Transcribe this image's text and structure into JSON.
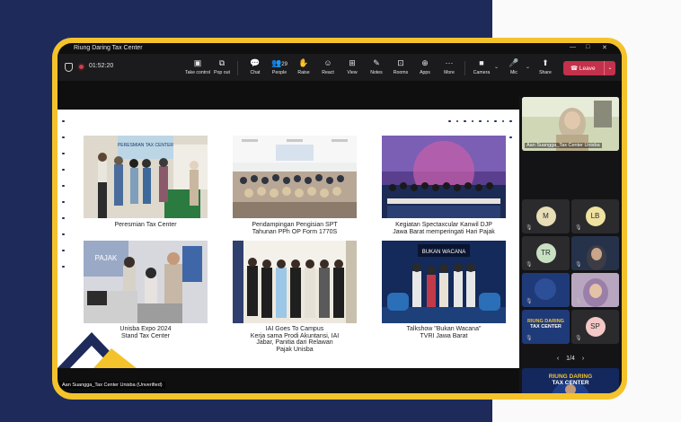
{
  "window": {
    "title": "Riung Daring Tax Center",
    "minimize": "—",
    "maximize": "□",
    "close": "✕"
  },
  "meeting": {
    "timer": "01:52:20",
    "toolbar": [
      {
        "id": "take-control",
        "label": "Take control",
        "icon": "▣"
      },
      {
        "id": "pop-out",
        "label": "Pop out",
        "icon": "⧉"
      },
      {
        "id": "chat",
        "label": "Chat",
        "icon": "💬"
      },
      {
        "id": "people",
        "label": "People",
        "icon": "👥",
        "count": "29"
      },
      {
        "id": "raise",
        "label": "Raise",
        "icon": "✋"
      },
      {
        "id": "react",
        "label": "React",
        "icon": "☺"
      },
      {
        "id": "view",
        "label": "View",
        "icon": "⊞"
      },
      {
        "id": "notes",
        "label": "Notes",
        "icon": "✎"
      },
      {
        "id": "rooms",
        "label": "Rooms",
        "icon": "⊡"
      },
      {
        "id": "apps",
        "label": "Apps",
        "icon": "⊕"
      },
      {
        "id": "more",
        "label": "More",
        "icon": "···"
      },
      {
        "id": "camera",
        "label": "Camera",
        "icon": "■"
      },
      {
        "id": "mic",
        "label": "Mic",
        "icon": "🎤"
      },
      {
        "id": "share",
        "label": "Share",
        "icon": "⬆"
      }
    ],
    "leave_label": "Leave"
  },
  "slide": {
    "captions": [
      "Peresmian Tax Center",
      "Pendampingan Pengisian SPT\nTahunan PPh OP Form 1770S",
      "Kegiatan Spectaxcular Kanwil DJP\nJawa Barat memperingati Hari Pajak",
      "Unisba Expo 2024\nStand Tax Center",
      "IAI Goes To Campus\nKerja sama Prodi Akuntansi, IAI\nJabar, Panitia dari Relawan\nPajak Unisba",
      "Talkshow \"Bukan Wacana\"\nTVRI Jawa Barat"
    ],
    "photo_text": {
      "p1_banner": "PERESMIAN TAX CENTER",
      "p4_sign": "PAJAK",
      "p6_banner": "BUKAN WACANA"
    }
  },
  "participants": {
    "speaker_name": "Aan Suangga_Tax Center Unisba",
    "tiles": [
      {
        "initials": "M",
        "color": "#e7ddb6"
      },
      {
        "initials": "LB",
        "color": "#efe1a0"
      },
      {
        "initials": "TR",
        "color": "#c7e0c2"
      },
      {
        "initials": "SP",
        "color": "#f4c7c7"
      }
    ],
    "pager": "1/4",
    "banner_line1": "RIUNG DARING",
    "banner_line2": "TAX CENTER"
  },
  "presenter_tag": "Aan Suangga_Tax Center Unisba (Unverified)"
}
